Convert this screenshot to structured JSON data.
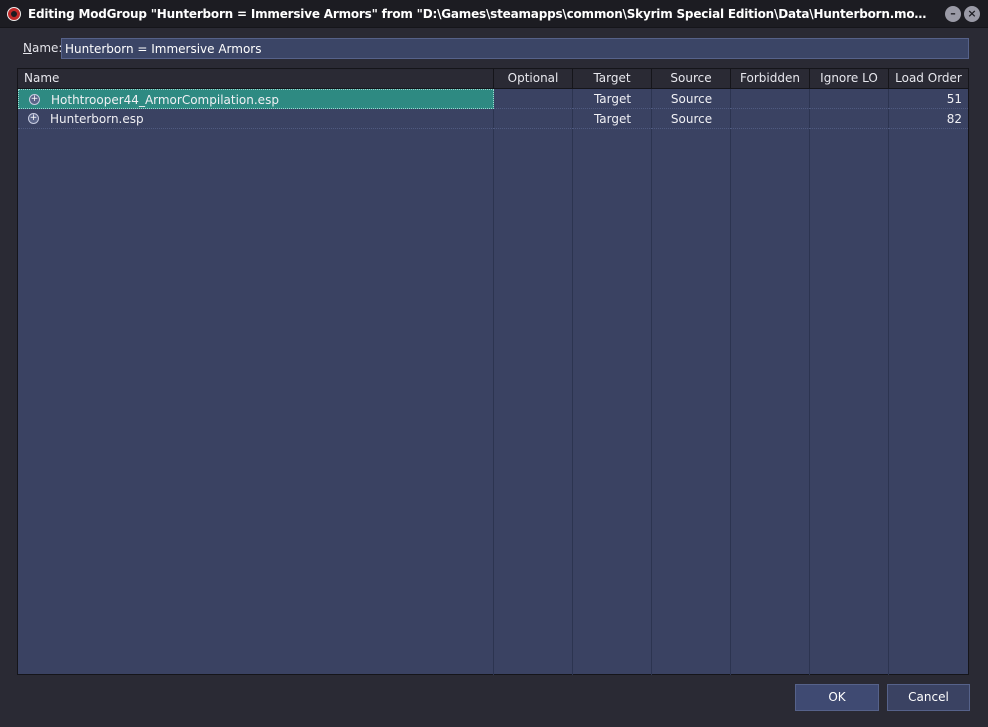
{
  "window": {
    "title": "Editing ModGroup \"Hunterborn = Immersive Armors\" from \"D:\\Games\\steamapps\\common\\Skyrim Special Edition\\Data\\Hunterborn.modgroups\"...",
    "minimize_icon": "minimize-icon",
    "close_icon": "close-icon"
  },
  "form": {
    "name_label_first": "N",
    "name_label_rest": "ame:",
    "name_value": "Hunterborn = Immersive Armors"
  },
  "table": {
    "columns": [
      "Name",
      "Optional",
      "Target",
      "Source",
      "Forbidden",
      "Ignore LO",
      "Load Order"
    ],
    "rows": [
      {
        "name": "Hothtrooper44_ArmorCompilation.esp",
        "optional": "",
        "target": "Target",
        "source": "Source",
        "forbidden": "",
        "ignore_lo": "",
        "load_order": "51",
        "selected": true
      },
      {
        "name": "Hunterborn.esp",
        "optional": "",
        "target": "Target",
        "source": "Source",
        "forbidden": "",
        "ignore_lo": "",
        "load_order": "82",
        "selected": false
      }
    ]
  },
  "buttons": {
    "ok": "OK",
    "cancel": "Cancel"
  },
  "colors": {
    "background": "#2a2a34",
    "table_bg": "#3a4262",
    "selection": "#2e8a82"
  }
}
